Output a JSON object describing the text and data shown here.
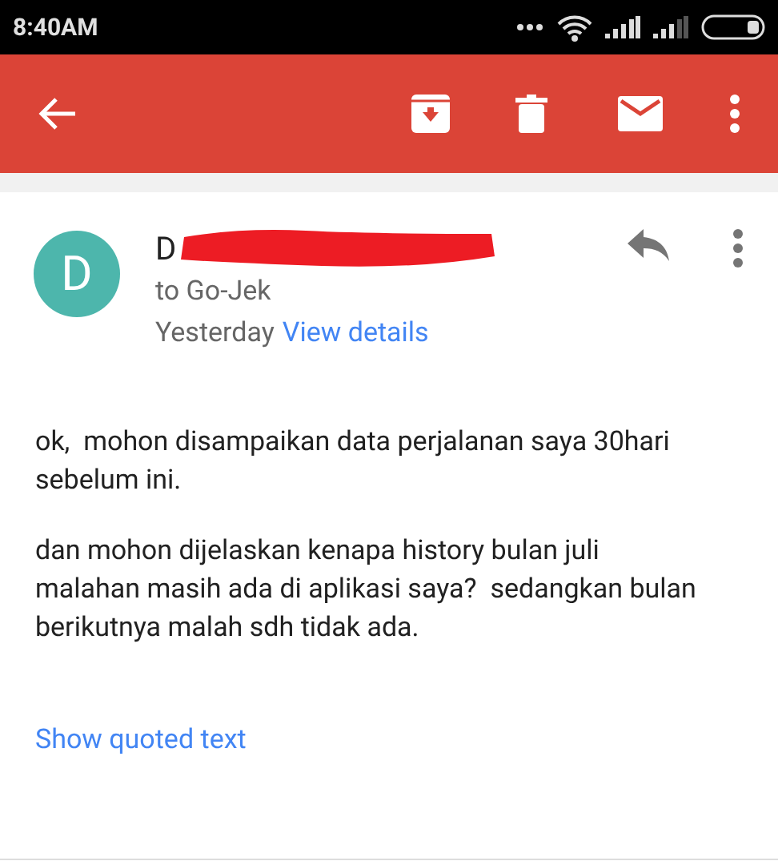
{
  "status_bar": {
    "time": "8:40AM"
  },
  "message": {
    "avatar_initial": "D",
    "sender": "D",
    "recipient": "to Go-Jek",
    "date": "Yesterday",
    "details_link": "View details",
    "body": [
      "ok,  mohon disampaikan data perjalanan saya 30hari sebelum ini.",
      "dan mohon dijelaskan kenapa history bulan juli malahan masih ada di aplikasi saya?  sedangkan bulan berikutnya malah sdh tidak ada."
    ],
    "quoted_link": "Show quoted text"
  }
}
